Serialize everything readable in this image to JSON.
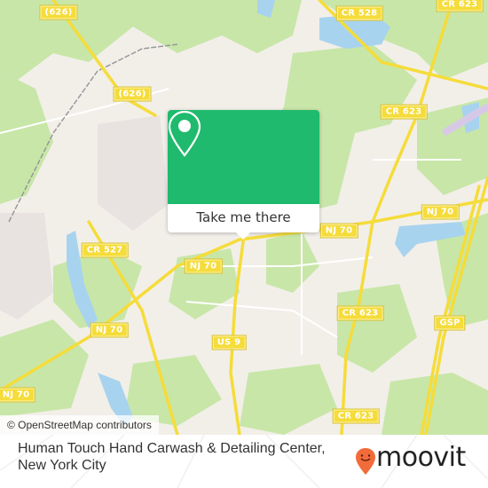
{
  "map": {
    "colors": {
      "background": "#f2efe9",
      "forest": "#c8e6a8",
      "water": "#a8d3ef",
      "road": "#f5dc3a",
      "residential": "#e8e2e0",
      "accent": "#1fba6d",
      "brand": "#f26b3a"
    },
    "road_labels": [
      {
        "text": "(626)"
      },
      {
        "text": "(626)"
      },
      {
        "text": "CR 528"
      },
      {
        "text": "CR 623"
      },
      {
        "text": "CR 623"
      },
      {
        "text": "NJ 70"
      },
      {
        "text": "NJ 70"
      },
      {
        "text": "CR 527"
      },
      {
        "text": "NJ 70"
      },
      {
        "text": "NJ 70"
      },
      {
        "text": "CR 623"
      },
      {
        "text": "GSP"
      },
      {
        "text": "US 9"
      },
      {
        "text": "NJ 70"
      },
      {
        "text": "CR 623"
      }
    ],
    "attribution": "© OpenStreetMap contributors"
  },
  "popup": {
    "icon": "map-pin-icon",
    "cta_label": "Take me there"
  },
  "footer": {
    "place_name": "Human Touch Hand Carwash & Detailing Center, New York City",
    "brand": "moovit",
    "brand_icon": "moovit-smiley-pin-icon"
  }
}
